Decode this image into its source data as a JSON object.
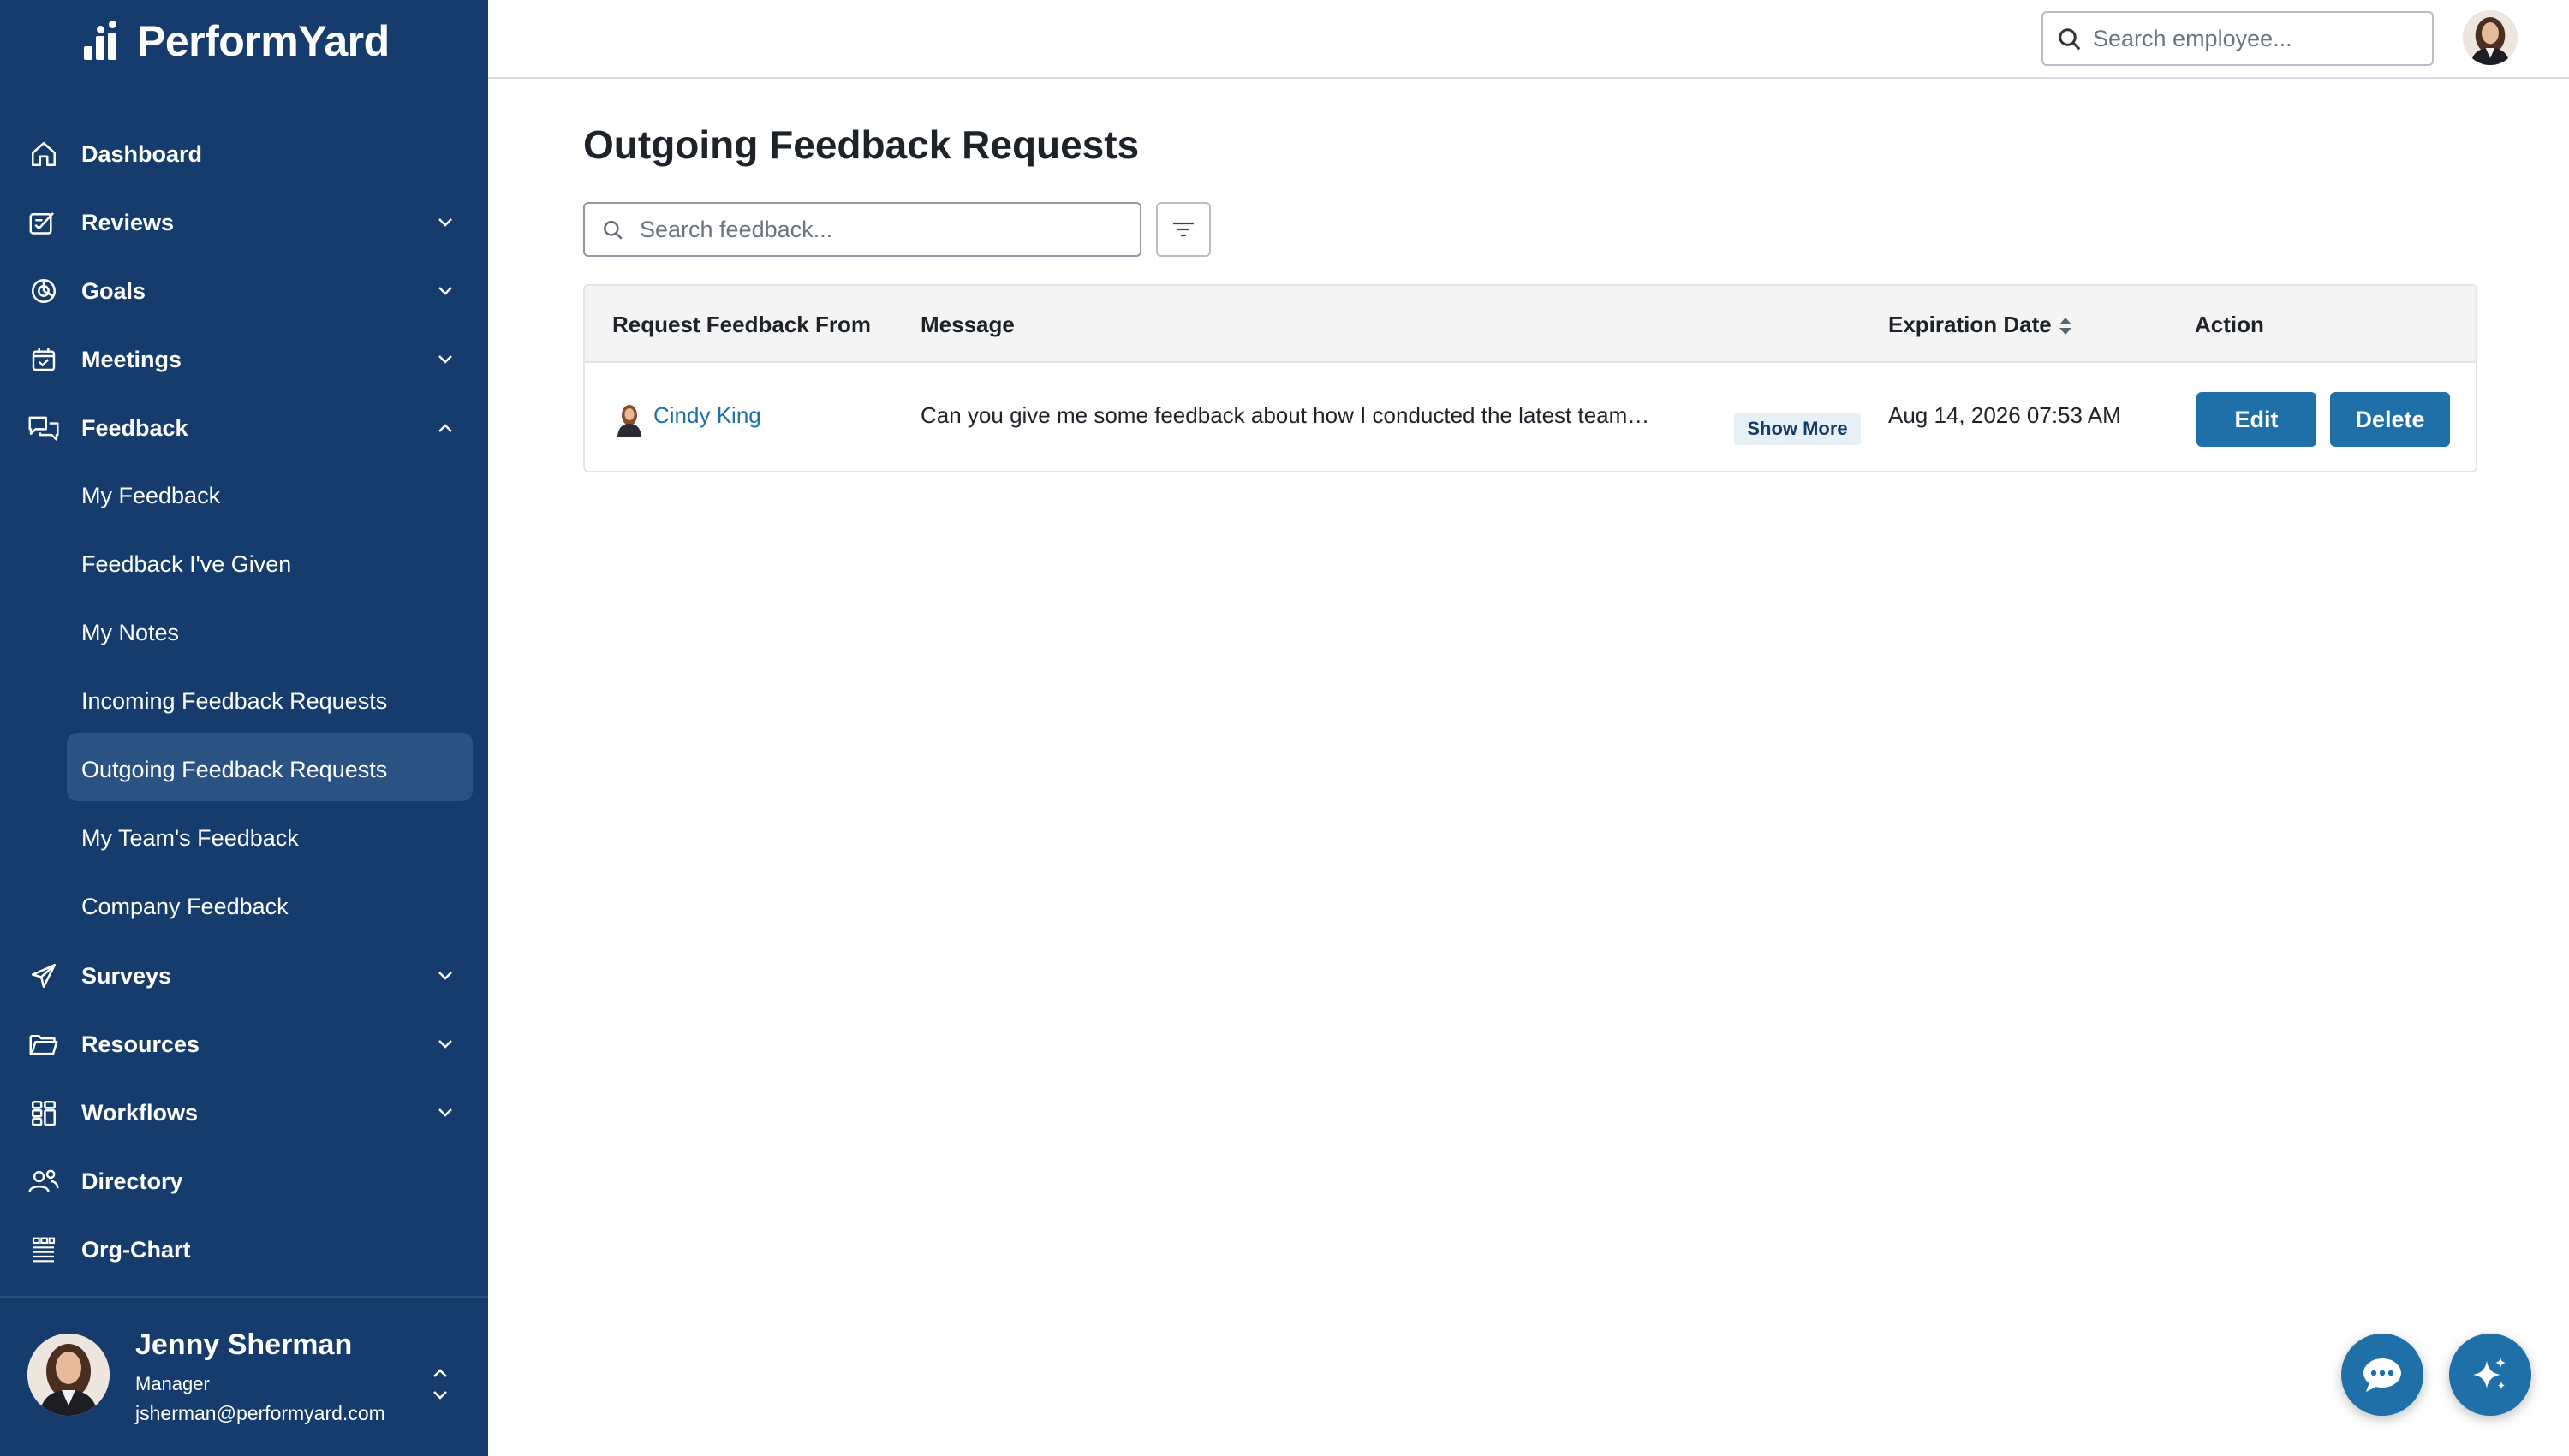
{
  "app": {
    "logo_text": "PerformYard"
  },
  "sidebar": {
    "items": [
      {
        "label": "Dashboard",
        "icon": "home-icon",
        "expandable": false
      },
      {
        "label": "Reviews",
        "icon": "review-icon",
        "expandable": true
      },
      {
        "label": "Goals",
        "icon": "goals-icon",
        "expandable": true
      },
      {
        "label": "Meetings",
        "icon": "calendar-icon",
        "expandable": true
      },
      {
        "label": "Feedback",
        "icon": "feedback-icon",
        "expandable": true,
        "expanded": true
      },
      {
        "label": "Surveys",
        "icon": "send-icon",
        "expandable": true
      },
      {
        "label": "Resources",
        "icon": "folder-icon",
        "expandable": true
      },
      {
        "label": "Workflows",
        "icon": "workflow-icon",
        "expandable": true
      },
      {
        "label": "Directory",
        "icon": "people-icon",
        "expandable": false
      },
      {
        "label": "Org-Chart",
        "icon": "org-chart-icon",
        "expandable": false
      }
    ],
    "feedback_sub": [
      {
        "label": "My Feedback"
      },
      {
        "label": "Feedback I've Given"
      },
      {
        "label": "My Notes"
      },
      {
        "label": "Incoming Feedback Requests"
      },
      {
        "label": "Outgoing Feedback Requests",
        "active": true
      },
      {
        "label": "My Team's Feedback"
      },
      {
        "label": "Company Feedback"
      }
    ],
    "user": {
      "name": "Jenny Sherman",
      "role": "Manager",
      "email": "jsherman@performyard.com"
    }
  },
  "topbar": {
    "search_placeholder": "Search employee..."
  },
  "main": {
    "title": "Outgoing Feedback Requests",
    "search_placeholder": "Search feedback...",
    "table": {
      "headers": {
        "from": "Request Feedback From",
        "message": "Message",
        "expiration": "Expiration Date",
        "action": "Action"
      },
      "rows": [
        {
          "from": "Cindy King",
          "message": "Can you give me some feedback about how I conducted the latest team…",
          "show_more": "Show More",
          "expiration": "Aug 14, 2026 07:53 AM",
          "edit_label": "Edit",
          "delete_label": "Delete"
        }
      ]
    }
  },
  "colors": {
    "sidebar_bg": "#153c6c",
    "sidebar_active": "#2a5283",
    "primary_button": "#1f6fa8",
    "link": "#1f6fa8"
  }
}
